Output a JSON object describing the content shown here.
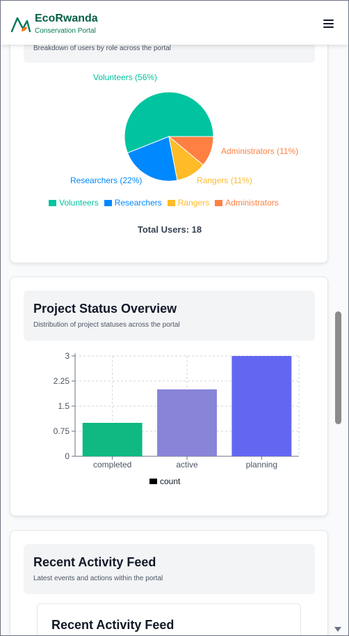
{
  "header": {
    "brand_name": "EcoRwanda",
    "brand_sub": "Conservation Portal",
    "logo_icon": "mountain-leaf-icon",
    "menu_icon": "hamburger-menu-icon"
  },
  "role_card": {
    "subtitle": "Breakdown of users by role across the portal",
    "total_users": "Total Users: 18",
    "chart_data": {
      "type": "pie",
      "categories": [
        "Volunteers",
        "Researchers",
        "Rangers",
        "Administrators"
      ],
      "values": [
        56,
        22,
        11,
        11
      ],
      "slice_labels": [
        "Volunteers (56%)",
        "Researchers (22%)",
        "Rangers (11%)",
        "Administrators (11%)"
      ],
      "colors": [
        "#00c49f",
        "#0088fe",
        "#ffbb28",
        "#ff8042"
      ],
      "legend": "bottom"
    }
  },
  "status_card": {
    "title": "Project Status Overview",
    "subtitle": "Distribution of project statuses across the portal",
    "chart_data": {
      "type": "bar",
      "categories": [
        "completed",
        "active",
        "planning"
      ],
      "series": [
        {
          "name": "count",
          "values": [
            1,
            2,
            3
          ]
        }
      ],
      "colors": [
        "#10b981",
        "#8884d8",
        "#6366f1"
      ],
      "y_ticks": [
        "0",
        "0.75",
        "1.5",
        "2.25",
        "3"
      ],
      "ylim": [
        0,
        3
      ],
      "grid": true,
      "legend": "bottom"
    }
  },
  "activity_card": {
    "title": "Recent Activity Feed",
    "subtitle": "Latest events and actions within the portal",
    "inner_title": "Recent Activity Feed"
  }
}
